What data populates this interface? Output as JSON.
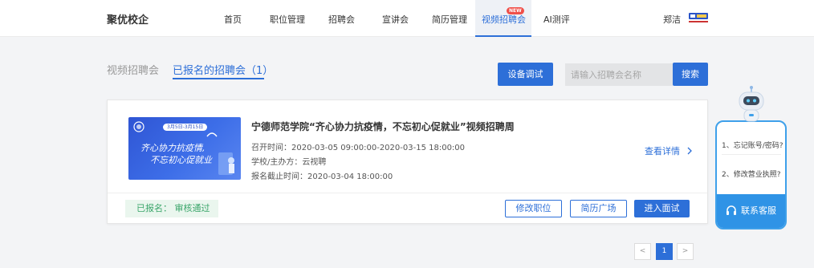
{
  "header": {
    "brand": "聚优校企",
    "nav": [
      {
        "label": "首页"
      },
      {
        "label": "职位管理"
      },
      {
        "label": "招聘会"
      },
      {
        "label": "宣讲会"
      },
      {
        "label": "简历管理"
      },
      {
        "label": "视频招聘会",
        "active": true,
        "badge": "NEW"
      },
      {
        "label": "AI测评"
      }
    ],
    "user_name": "郑洁",
    "user_logo_icon": "school-logo-icon"
  },
  "tabs": [
    {
      "label": "视频招聘会",
      "active": false
    },
    {
      "label": "已报名的招聘会（1）",
      "active": true
    }
  ],
  "toolbar": {
    "device_test_label": "设备调试",
    "search_placeholder": "请输入招聘会名称",
    "search_label": "搜索"
  },
  "event": {
    "poster": {
      "date_range": "3月5日-3月15日",
      "line1": "齐心协力抗疫情,",
      "line2": "不忘初心促就业"
    },
    "title": "宁德师范学院“齐心协力抗疫情，不忘初心促就业”视频招聘周",
    "start_time": "召开时间：2020-03-05 09:00:00-2020-03-15 18:00:00",
    "organizer": "学校/主办方：云视聘",
    "deadline": "报名截止时间：2020-03-04 18:00:00",
    "detail_link": "查看详情",
    "status": "已报名： 审核通过",
    "actions": {
      "edit_position": "修改职位",
      "resume_square": "简历广场",
      "enter_interview": "进入面试"
    }
  },
  "pagination": {
    "prev": "<",
    "current": "1",
    "next": ">"
  },
  "customer_service": {
    "questions": [
      "1、忘记账号/密码?",
      "2、修改营业执照?"
    ],
    "contact_label": "联系客服"
  },
  "colors": {
    "accent": "#2d6fd8",
    "success": "#3aa56a",
    "badge": "#f0504a"
  }
}
